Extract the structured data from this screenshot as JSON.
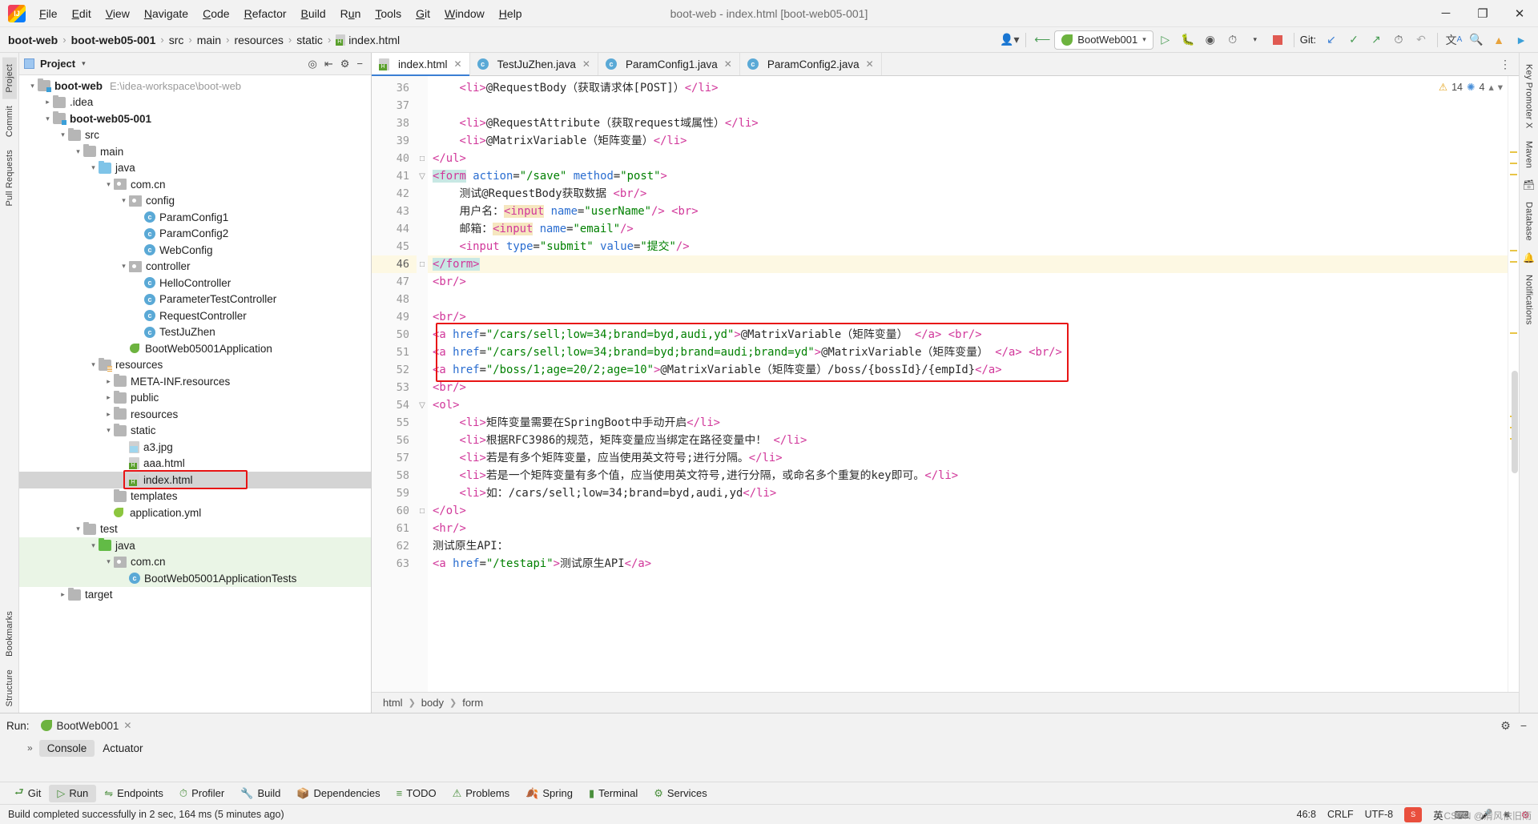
{
  "window": {
    "title": "boot-web - index.html [boot-web05-001]",
    "minimize": "─",
    "maximize": "❐",
    "close": "✕"
  },
  "menu": [
    "File",
    "Edit",
    "View",
    "Navigate",
    "Code",
    "Refactor",
    "Build",
    "Run",
    "Tools",
    "Git",
    "Window",
    "Help"
  ],
  "breadcrumb": {
    "items": [
      "boot-web",
      "boot-web05-001",
      "src",
      "main",
      "resources",
      "static",
      "index.html"
    ],
    "separator": "›"
  },
  "toolbar": {
    "run_config": "BootWeb001",
    "git_label": "Git:",
    "icons": [
      "user-icon",
      "back-arrow-icon",
      "run-icon",
      "debug-icon",
      "run-with-coverage-icon",
      "profiler-icon",
      "stop-icon",
      "update-project-icon",
      "commit-icon",
      "push-icon",
      "history-icon",
      "rollback-icon",
      "translate-icon",
      "search-icon",
      "upload-icon",
      "plugin-icon"
    ]
  },
  "left_strip": {
    "tabs": [
      "Project",
      "Commit",
      "Pull Requests"
    ],
    "bottom_tabs": [
      "Bookmarks",
      "Structure"
    ]
  },
  "right_strip": {
    "tabs": [
      "Key Promoter X",
      "Maven",
      "Database",
      "Notifications"
    ]
  },
  "project_panel": {
    "title": "Project",
    "tree": [
      {
        "depth": 0,
        "arrow": "v",
        "icon": "folder-module",
        "label": "boot-web",
        "bold": true,
        "path": "E:\\idea-workspace\\boot-web"
      },
      {
        "depth": 1,
        "arrow": ">",
        "icon": "folder",
        "label": ".idea"
      },
      {
        "depth": 1,
        "arrow": "v",
        "icon": "folder-module",
        "label": "boot-web05-001",
        "bold": true
      },
      {
        "depth": 2,
        "arrow": "v",
        "icon": "folder",
        "label": "src"
      },
      {
        "depth": 3,
        "arrow": "v",
        "icon": "folder",
        "label": "main"
      },
      {
        "depth": 4,
        "arrow": "v",
        "icon": "folder-source",
        "label": "java"
      },
      {
        "depth": 5,
        "arrow": "v",
        "icon": "package",
        "label": "com.cn"
      },
      {
        "depth": 6,
        "arrow": "v",
        "icon": "package",
        "label": "config"
      },
      {
        "depth": 7,
        "arrow": "",
        "icon": "class",
        "label": "ParamConfig1"
      },
      {
        "depth": 7,
        "arrow": "",
        "icon": "class",
        "label": "ParamConfig2"
      },
      {
        "depth": 7,
        "arrow": "",
        "icon": "class",
        "label": "WebConfig"
      },
      {
        "depth": 6,
        "arrow": "v",
        "icon": "package",
        "label": "controller"
      },
      {
        "depth": 7,
        "arrow": "",
        "icon": "class",
        "label": "HelloController"
      },
      {
        "depth": 7,
        "arrow": "",
        "icon": "class",
        "label": "ParameterTestController"
      },
      {
        "depth": 7,
        "arrow": "",
        "icon": "class",
        "label": "RequestController"
      },
      {
        "depth": 7,
        "arrow": "",
        "icon": "class",
        "label": "TestJuZhen"
      },
      {
        "depth": 6,
        "arrow": "",
        "icon": "spring-class",
        "label": "BootWeb05001Application"
      },
      {
        "depth": 4,
        "arrow": "v",
        "icon": "folder-resource",
        "label": "resources"
      },
      {
        "depth": 5,
        "arrow": ">",
        "icon": "folder",
        "label": "META-INF.resources"
      },
      {
        "depth": 5,
        "arrow": ">",
        "icon": "folder",
        "label": "public"
      },
      {
        "depth": 5,
        "arrow": ">",
        "icon": "folder",
        "label": "resources"
      },
      {
        "depth": 5,
        "arrow": "v",
        "icon": "folder",
        "label": "static"
      },
      {
        "depth": 6,
        "arrow": "",
        "icon": "file-jpg",
        "label": "a3.jpg"
      },
      {
        "depth": 6,
        "arrow": "",
        "icon": "file-html",
        "label": "aaa.html"
      },
      {
        "depth": 6,
        "arrow": "",
        "icon": "file-html",
        "label": "index.html",
        "selected": true,
        "highlight": true
      },
      {
        "depth": 5,
        "arrow": "",
        "icon": "folder",
        "label": "templates"
      },
      {
        "depth": 5,
        "arrow": "",
        "icon": "file-yml",
        "label": "application.yml"
      },
      {
        "depth": 3,
        "arrow": "v",
        "icon": "folder",
        "label": "test"
      },
      {
        "depth": 4,
        "arrow": "v",
        "icon": "folder-test",
        "label": "java",
        "greenbg": true
      },
      {
        "depth": 5,
        "arrow": "v",
        "icon": "package",
        "label": "com.cn",
        "greenbg": true
      },
      {
        "depth": 6,
        "arrow": "",
        "icon": "class",
        "label": "BootWeb05001ApplicationTests",
        "greenbg": true
      },
      {
        "depth": 2,
        "arrow": ">",
        "icon": "folder",
        "label": "target"
      }
    ]
  },
  "editor": {
    "tabs": [
      {
        "label": "index.html",
        "icon": "file-html",
        "active": true
      },
      {
        "label": "TestJuZhen.java",
        "icon": "class",
        "active": false
      },
      {
        "label": "ParamConfig1.java",
        "icon": "class",
        "active": false
      },
      {
        "label": "ParamConfig2.java",
        "icon": "class",
        "active": false
      }
    ],
    "inspection": {
      "warnings": "14",
      "weak_warnings": "4"
    },
    "breadcrumbs": [
      "html",
      "body",
      "form"
    ],
    "first_line": 36,
    "lines": [
      {
        "n": 36,
        "clipped": true,
        "parts": [
          {
            "t": "    ",
            "c": "txt"
          },
          {
            "t": "<li>",
            "c": "ptag"
          },
          {
            "t": "@RequestBody（获取请求体[POST]）",
            "c": "txt"
          },
          {
            "t": "</li>",
            "c": "ptag"
          }
        ]
      },
      {
        "n": 37,
        "parts": []
      },
      {
        "n": 38,
        "parts": [
          {
            "t": "    ",
            "c": "txt"
          },
          {
            "t": "<li>",
            "c": "ptag"
          },
          {
            "t": "@RequestAttribute（获取request域属性）",
            "c": "txt"
          },
          {
            "t": "</li>",
            "c": "ptag"
          }
        ]
      },
      {
        "n": 39,
        "parts": [
          {
            "t": "    ",
            "c": "txt"
          },
          {
            "t": "<li>",
            "c": "ptag"
          },
          {
            "t": "@MatrixVariable（矩阵变量）",
            "c": "txt"
          },
          {
            "t": "</li>",
            "c": "ptag"
          }
        ]
      },
      {
        "n": 40,
        "fold": "end",
        "parts": [
          {
            "t": "</ul>",
            "c": "ptag"
          }
        ]
      },
      {
        "n": 41,
        "fold": "start",
        "parts": [
          {
            "t": "<form",
            "c": "ptag hl-form"
          },
          {
            "t": " ",
            "c": "txt"
          },
          {
            "t": "action",
            "c": "attr"
          },
          {
            "t": "=",
            "c": "txt"
          },
          {
            "t": "\"/save\"",
            "c": "val"
          },
          {
            "t": " ",
            "c": "txt"
          },
          {
            "t": "method",
            "c": "attr"
          },
          {
            "t": "=",
            "c": "txt"
          },
          {
            "t": "\"post\"",
            "c": "val"
          },
          {
            "t": ">",
            "c": "ptag"
          }
        ]
      },
      {
        "n": 42,
        "parts": [
          {
            "t": "    测试@RequestBody获取数据 ",
            "c": "txt"
          },
          {
            "t": "<br/>",
            "c": "ptag"
          }
        ]
      },
      {
        "n": 43,
        "parts": [
          {
            "t": "    用户名：",
            "c": "txt"
          },
          {
            "t": "<input",
            "c": "ptag hl-input"
          },
          {
            "t": " ",
            "c": "txt"
          },
          {
            "t": "name",
            "c": "attr"
          },
          {
            "t": "=",
            "c": "txt"
          },
          {
            "t": "\"userName\"",
            "c": "val"
          },
          {
            "t": "/>",
            "c": "ptag"
          },
          {
            "t": " ",
            "c": "txt"
          },
          {
            "t": "<br>",
            "c": "ptag"
          }
        ]
      },
      {
        "n": 44,
        "parts": [
          {
            "t": "    邮箱：",
            "c": "txt"
          },
          {
            "t": "<input",
            "c": "ptag hl-input"
          },
          {
            "t": " ",
            "c": "txt"
          },
          {
            "t": "name",
            "c": "attr"
          },
          {
            "t": "=",
            "c": "txt"
          },
          {
            "t": "\"email\"",
            "c": "val"
          },
          {
            "t": "/>",
            "c": "ptag"
          }
        ]
      },
      {
        "n": 45,
        "parts": [
          {
            "t": "    ",
            "c": "txt"
          },
          {
            "t": "<input",
            "c": "ptag"
          },
          {
            "t": " ",
            "c": "txt"
          },
          {
            "t": "type",
            "c": "attr"
          },
          {
            "t": "=",
            "c": "txt"
          },
          {
            "t": "\"submit\"",
            "c": "val"
          },
          {
            "t": " ",
            "c": "txt"
          },
          {
            "t": "value",
            "c": "attr"
          },
          {
            "t": "=",
            "c": "txt"
          },
          {
            "t": "\"提交\"",
            "c": "val"
          },
          {
            "t": "/>",
            "c": "ptag"
          }
        ]
      },
      {
        "n": 46,
        "current": true,
        "fold": "end",
        "parts": [
          {
            "t": "</form>",
            "c": "ptag hl-form"
          }
        ]
      },
      {
        "n": 47,
        "parts": [
          {
            "t": "<br/>",
            "c": "ptag"
          }
        ]
      },
      {
        "n": 48,
        "parts": []
      },
      {
        "n": 49,
        "parts": [
          {
            "t": "<br/>",
            "c": "ptag"
          }
        ]
      },
      {
        "n": 50,
        "boxed": true,
        "parts": [
          {
            "t": "<a",
            "c": "ptag"
          },
          {
            "t": " ",
            "c": "txt"
          },
          {
            "t": "href",
            "c": "attr"
          },
          {
            "t": "=",
            "c": "txt"
          },
          {
            "t": "\"/cars/sell;low=34;brand=byd,audi,yd\"",
            "c": "val"
          },
          {
            "t": ">",
            "c": "ptag"
          },
          {
            "t": "@MatrixVariable（矩阵变量）",
            "c": "txt"
          },
          {
            "t": " ",
            "c": "txt"
          },
          {
            "t": "</a>",
            "c": "ptag"
          },
          {
            "t": " ",
            "c": "txt"
          },
          {
            "t": "<br/>",
            "c": "ptag"
          }
        ]
      },
      {
        "n": 51,
        "boxed": true,
        "parts": [
          {
            "t": "<a",
            "c": "ptag"
          },
          {
            "t": " ",
            "c": "txt"
          },
          {
            "t": "href",
            "c": "attr"
          },
          {
            "t": "=",
            "c": "txt"
          },
          {
            "t": "\"/cars/sell;low=34;brand=byd;brand=audi;brand=yd\"",
            "c": "val"
          },
          {
            "t": ">",
            "c": "ptag"
          },
          {
            "t": "@MatrixVariable（矩阵变量）",
            "c": "txt"
          },
          {
            "t": " ",
            "c": "txt"
          },
          {
            "t": "</a>",
            "c": "ptag"
          },
          {
            "t": " ",
            "c": "txt"
          },
          {
            "t": "<br/>",
            "c": "ptag"
          }
        ]
      },
      {
        "n": 52,
        "boxed": true,
        "parts": [
          {
            "t": "<a",
            "c": "ptag"
          },
          {
            "t": " ",
            "c": "txt"
          },
          {
            "t": "href",
            "c": "attr"
          },
          {
            "t": "=",
            "c": "txt"
          },
          {
            "t": "\"/boss/1;age=20/2;age=10\"",
            "c": "val"
          },
          {
            "t": ">",
            "c": "ptag"
          },
          {
            "t": "@MatrixVariable（矩阵变量）/boss/{bossId}/{empId}",
            "c": "txt"
          },
          {
            "t": "</a>",
            "c": "ptag"
          }
        ]
      },
      {
        "n": 53,
        "parts": [
          {
            "t": "<br/>",
            "c": "ptag"
          }
        ]
      },
      {
        "n": 54,
        "fold": "start",
        "parts": [
          {
            "t": "<ol>",
            "c": "ptag"
          }
        ]
      },
      {
        "n": 55,
        "parts": [
          {
            "t": "    ",
            "c": "txt"
          },
          {
            "t": "<li>",
            "c": "ptag"
          },
          {
            "t": "矩阵变量需要在SpringBoot中手动开启",
            "c": "txt"
          },
          {
            "t": "</li>",
            "c": "ptag"
          }
        ]
      },
      {
        "n": 56,
        "parts": [
          {
            "t": "    ",
            "c": "txt"
          },
          {
            "t": "<li>",
            "c": "ptag"
          },
          {
            "t": "根据RFC3986的规范，矩阵变量应当绑定在路径变量中！ ",
            "c": "txt"
          },
          {
            "t": "</li>",
            "c": "ptag"
          }
        ]
      },
      {
        "n": 57,
        "parts": [
          {
            "t": "    ",
            "c": "txt"
          },
          {
            "t": "<li>",
            "c": "ptag"
          },
          {
            "t": "若是有多个矩阵变量，应当使用英文符号;进行分隔。",
            "c": "txt"
          },
          {
            "t": "</li>",
            "c": "ptag"
          }
        ]
      },
      {
        "n": 58,
        "parts": [
          {
            "t": "    ",
            "c": "txt"
          },
          {
            "t": "<li>",
            "c": "ptag"
          },
          {
            "t": "若是一个矩阵变量有多个值，应当使用英文符号,进行分隔，或命名多个重复的key即可。",
            "c": "txt"
          },
          {
            "t": "</li>",
            "c": "ptag"
          }
        ]
      },
      {
        "n": 59,
        "parts": [
          {
            "t": "    ",
            "c": "txt"
          },
          {
            "t": "<li>",
            "c": "ptag"
          },
          {
            "t": "如：/cars/sell;low=34;brand=byd,audi,yd",
            "c": "txt"
          },
          {
            "t": "</li>",
            "c": "ptag"
          }
        ]
      },
      {
        "n": 60,
        "fold": "end",
        "parts": [
          {
            "t": "</ol>",
            "c": "ptag"
          }
        ]
      },
      {
        "n": 61,
        "parts": [
          {
            "t": "<hr/>",
            "c": "ptag"
          }
        ]
      },
      {
        "n": 62,
        "parts": [
          {
            "t": "测试原生API：",
            "c": "txt"
          }
        ]
      },
      {
        "n": 63,
        "parts": [
          {
            "t": "<a",
            "c": "ptag"
          },
          {
            "t": " ",
            "c": "txt"
          },
          {
            "t": "href",
            "c": "attr"
          },
          {
            "t": "=",
            "c": "txt"
          },
          {
            "t": "\"/testapi\"",
            "c": "val"
          },
          {
            "t": ">",
            "c": "ptag"
          },
          {
            "t": "测试原生API",
            "c": "txt"
          },
          {
            "t": "</a>",
            "c": "ptag"
          }
        ]
      }
    ]
  },
  "run_panel": {
    "label": "Run:",
    "tab": "BootWeb001",
    "sub_tabs": [
      "Console",
      "Actuator"
    ],
    "expand_icon": "»"
  },
  "tool_windows": [
    {
      "label": "Git",
      "icon": "git-icon"
    },
    {
      "label": "Run",
      "icon": "run-icon",
      "active": true
    },
    {
      "label": "Endpoints",
      "icon": "endpoints-icon"
    },
    {
      "label": "Profiler",
      "icon": "profiler-icon"
    },
    {
      "label": "Build",
      "icon": "build-icon"
    },
    {
      "label": "Dependencies",
      "icon": "dependencies-icon"
    },
    {
      "label": "TODO",
      "icon": "todo-icon"
    },
    {
      "label": "Problems",
      "icon": "problems-icon"
    },
    {
      "label": "Spring",
      "icon": "spring-icon"
    },
    {
      "label": "Terminal",
      "icon": "terminal-icon"
    },
    {
      "label": "Services",
      "icon": "services-icon"
    }
  ],
  "status_bar": {
    "message": "Build completed successfully in 2 sec, 164 ms (5 minutes ago)",
    "caret": "46:8",
    "line_separator": "CRLF",
    "encoding": "UTF-8",
    "ime": "英",
    "watermark": "CSDN @清风依旧雨"
  },
  "colors": {
    "accent_blue": "#3b7fd4",
    "selection_red": "#e81414",
    "spring_green": "#6db33f",
    "warning_yellow": "#e3a21a"
  }
}
